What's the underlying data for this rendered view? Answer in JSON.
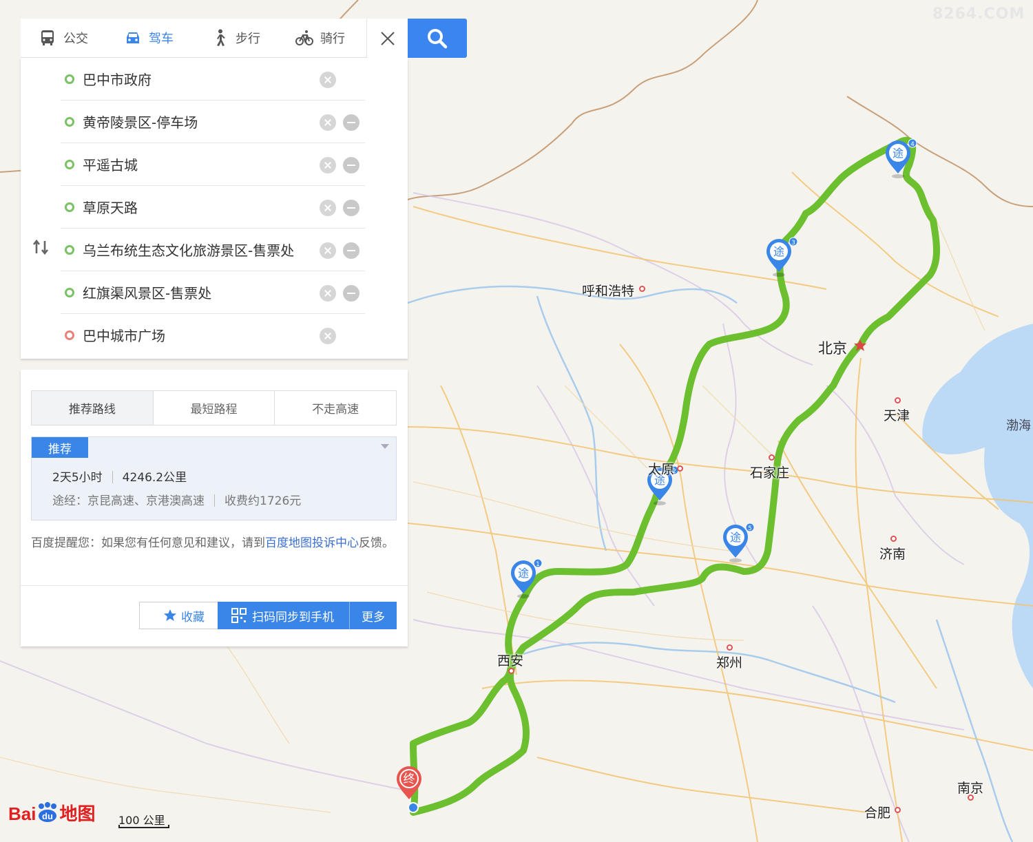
{
  "modes": [
    {
      "label": "公交",
      "icon": "bus-icon"
    },
    {
      "label": "驾车",
      "icon": "car-icon",
      "active": true
    },
    {
      "label": "步行",
      "icon": "walk-icon"
    },
    {
      "label": "骑行",
      "icon": "bike-icon"
    }
  ],
  "stops": [
    {
      "name": "巴中市政府",
      "type": "start"
    },
    {
      "name": "黄帝陵景区-停车场",
      "type": "via"
    },
    {
      "name": "平遥古城",
      "type": "via"
    },
    {
      "name": "草原天路",
      "type": "via"
    },
    {
      "name": "乌兰布统生态文化旅游景区-售票处",
      "type": "via"
    },
    {
      "name": "红旗渠风景区-售票处",
      "type": "via"
    },
    {
      "name": "巴中城市广场",
      "type": "end"
    }
  ],
  "route_tabs": [
    "推荐路线",
    "最短路程",
    "不走高速"
  ],
  "route": {
    "badge": "推荐",
    "duration": "2天5小时",
    "distance": "4246.2公里",
    "via": "途经：京昆高速、京港澳高速",
    "toll": "收费约1726元"
  },
  "notice": {
    "prefix": "百度提醒您：如果您有任何意见和建议，请到",
    "link": "百度地图投诉中心",
    "suffix": "反馈。"
  },
  "actions": {
    "favorite": "收藏",
    "sync": "扫码同步到手机",
    "more": "更多"
  },
  "map": {
    "cities": [
      {
        "name": "呼和浩特"
      },
      {
        "name": "北京"
      },
      {
        "name": "天津"
      },
      {
        "name": "石家庄"
      },
      {
        "name": "太原"
      },
      {
        "name": "济南"
      },
      {
        "name": "西安"
      },
      {
        "name": "郑州"
      },
      {
        "name": "南京"
      },
      {
        "name": "合肥"
      }
    ],
    "sea": "渤海",
    "waypoint_label": "途",
    "end_label": "终",
    "waypoint_numbers": [
      "1",
      "2",
      "3",
      "4",
      "5"
    ],
    "scale": "100 公里",
    "logo": "Bai地图",
    "watermark": "8264.COM",
    "route_color": "#6cbf2f"
  }
}
